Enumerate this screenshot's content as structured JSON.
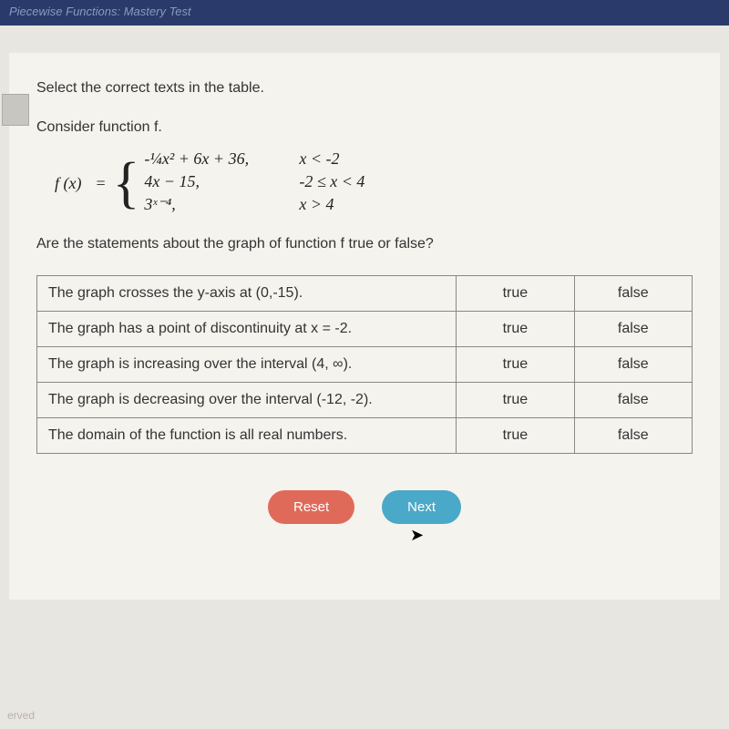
{
  "header": {
    "title": "Piecewise Functions: Mastery Test"
  },
  "panel": {
    "instruction": "Select the correct texts in the table.",
    "subtitle": "Consider function f.",
    "function": {
      "fx": "f (x)",
      "eq": "=",
      "pieces": [
        {
          "expr": "-¼x² + 6x + 36,",
          "cond": "x < -2"
        },
        {
          "expr": "4x − 15,",
          "cond": "-2 ≤ x < 4"
        },
        {
          "expr": "3ˣ⁻⁴,",
          "cond": "x > 4"
        }
      ]
    },
    "question": "Are the statements about the graph of function f true or false?",
    "table": {
      "rows": [
        {
          "statement": "The graph crosses the y-axis at (0,-15).",
          "true": "true",
          "false": "false"
        },
        {
          "statement": "The graph has a point of discontinuity at x = -2.",
          "true": "true",
          "false": "false"
        },
        {
          "statement": "The graph is increasing over the interval (4, ∞).",
          "true": "true",
          "false": "false"
        },
        {
          "statement": "The graph is decreasing over the interval (-12, -2).",
          "true": "true",
          "false": "false"
        },
        {
          "statement": "The domain of the function is all real numbers.",
          "true": "true",
          "false": "false"
        }
      ]
    },
    "buttons": {
      "reset": "Reset",
      "next": "Next"
    }
  },
  "footer": {
    "text": "erved"
  }
}
